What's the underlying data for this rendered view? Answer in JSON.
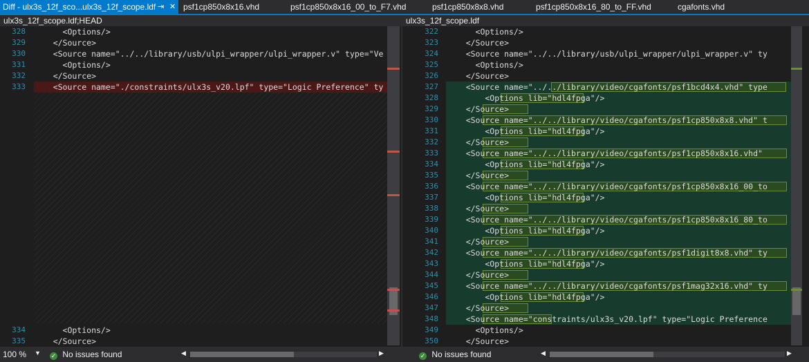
{
  "tabs": {
    "active_label": "Diff - ulx3s_12f_sco...ulx3s_12f_scope.ldf",
    "items": [
      "psf1cp850x8x16.vhd",
      "psf1cp850x8x16_00_to_F7.vhd",
      "psf1cp850x8x8.vhd",
      "psf1cp850x8x16_80_to_FF.vhd",
      "cgafonts.vhd"
    ]
  },
  "left": {
    "title": "ulx3s_12f_scope.ldf;HEAD",
    "top_lines": [
      {
        "n": "328",
        "text": "      <Options/>"
      },
      {
        "n": "329",
        "text": "    </Source>"
      },
      {
        "n": "330",
        "text": "    <Source name=\"../../library/usb/ulpi_wrapper/ulpi_wrapper.v\" type=\"Ve"
      },
      {
        "n": "331",
        "text": "      <Options/>"
      },
      {
        "n": "332",
        "text": "    </Source>"
      },
      {
        "n": "333",
        "text": "    <Source name=\"./constraints/ulx3s_v20.lpf\" type=\"Logic Preference\" ty"
      }
    ],
    "bottom_lines": [
      {
        "n": "334",
        "text": "      <Options/>"
      },
      {
        "n": "335",
        "text": "    </Source>"
      }
    ]
  },
  "right": {
    "title": "ulx3s_12f_scope.ldf",
    "lines": [
      {
        "n": "322",
        "text": "      <Options/>"
      },
      {
        "n": "323",
        "text": "    </Source>"
      },
      {
        "n": "324",
        "text": "    <Source name=\"../../library/usb/ulpi_wrapper/ulpi_wrapper.v\" ty"
      },
      {
        "n": "325",
        "text": "      <Options/>"
      },
      {
        "n": "326",
        "text": "    </Source>"
      },
      {
        "n": "327",
        "text": "    <Source name=\"../../library/video/cgafonts/psf1bcd4x4.vhd\" type"
      },
      {
        "n": "328",
        "text": "        <Options lib=\"hdl4fpga\"/>"
      },
      {
        "n": "329",
        "text": "    </Source>"
      },
      {
        "n": "330",
        "text": "    <Source name=\"../../library/video/cgafonts/psf1cp850x8x8.vhd\" t"
      },
      {
        "n": "331",
        "text": "        <Options lib=\"hdl4fpga\"/>"
      },
      {
        "n": "332",
        "text": "    </Source>"
      },
      {
        "n": "333",
        "text": "    <Source name=\"../../library/video/cgafonts/psf1cp850x8x16.vhd\""
      },
      {
        "n": "334",
        "text": "        <Options lib=\"hdl4fpga\"/>"
      },
      {
        "n": "335",
        "text": "    </Source>"
      },
      {
        "n": "336",
        "text": "    <Source name=\"../../library/video/cgafonts/psf1cp850x8x16_00_to"
      },
      {
        "n": "337",
        "text": "        <Options lib=\"hdl4fpga\"/>"
      },
      {
        "n": "338",
        "text": "    </Source>"
      },
      {
        "n": "339",
        "text": "    <Source name=\"../../library/video/cgafonts/psf1cp850x8x16_80_to"
      },
      {
        "n": "340",
        "text": "        <Options lib=\"hdl4fpga\"/>"
      },
      {
        "n": "341",
        "text": "    </Source>"
      },
      {
        "n": "342",
        "text": "    <Source name=\"../../library/video/cgafonts/psf1digit8x8.vhd\" ty"
      },
      {
        "n": "343",
        "text": "        <Options lib=\"hdl4fpga\"/>"
      },
      {
        "n": "344",
        "text": "    </Source>"
      },
      {
        "n": "345",
        "text": "    <Source name=\"../../library/video/cgafonts/psf1mag32x16.vhd\" ty"
      },
      {
        "n": "346",
        "text": "        <Options lib=\"hdl4fpga\"/>"
      },
      {
        "n": "347",
        "text": "    </Source>"
      },
      {
        "n": "348",
        "text": "    <Source name=\"constraints/ulx3s_v20.lpf\" type=\"Logic Preference"
      },
      {
        "n": "349",
        "text": "      <Options/>"
      },
      {
        "n": "350",
        "text": "    </Source>"
      }
    ]
  },
  "status": {
    "zoom": "100 %",
    "left_issues": "No issues found",
    "right_issues": "No issues found"
  },
  "colors": {
    "accent": "#007acc",
    "deleted": "#4b1818",
    "added": "#173b2c",
    "line_number": "#2b91af"
  }
}
